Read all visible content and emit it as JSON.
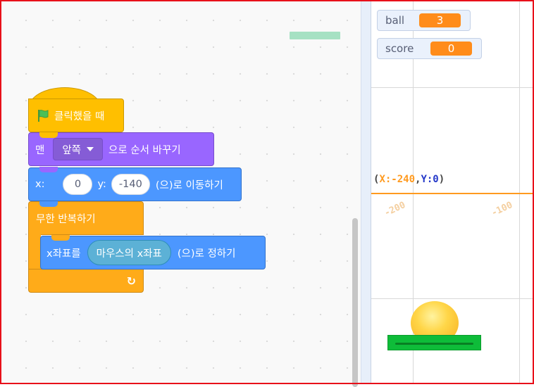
{
  "code_area": {
    "hat_block": {
      "label": "클릭했을 때"
    },
    "looks_block": {
      "prefix": "맨",
      "dropdown": "앞쪽",
      "suffix": "으로 순서 바꾸기"
    },
    "motion_block": {
      "x_label": "x:",
      "x_value": "0",
      "y_label": "y:",
      "y_value": "-140",
      "suffix": "(으)로 이동하기"
    },
    "forever_block": {
      "label": "무한 반복하기"
    },
    "set_x_block": {
      "prefix": "x좌표를",
      "reporter": "마우스의 x좌표",
      "suffix": "(으)로 정하기"
    }
  },
  "stage": {
    "monitors": [
      {
        "name": "ball",
        "value": "3"
      },
      {
        "name": "score",
        "value": "0"
      }
    ],
    "coordinate_readout": {
      "open": "(",
      "x": "X:-240",
      "sep": ",",
      "y": "Y:0",
      "close": ")"
    },
    "axis_ticks": [
      "-200",
      "-100"
    ]
  },
  "colors": {
    "events": "#ffbf00",
    "looks": "#9966ff",
    "motion": "#4c97ff",
    "control": "#ffab19",
    "sensing": "#5cb1d6",
    "monitor_value": "#ff8c1a",
    "frame": "#e8101a"
  }
}
